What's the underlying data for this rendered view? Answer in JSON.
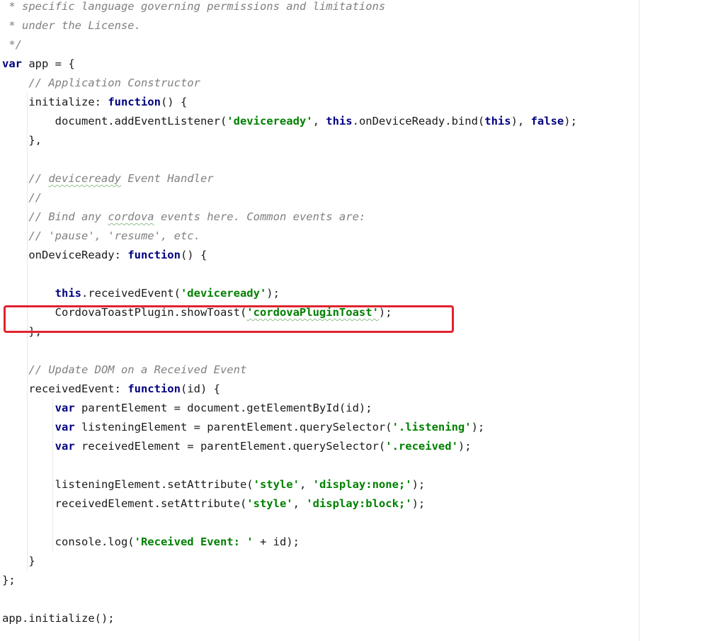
{
  "code": {
    "l0": " * specific language governing permissions and limitations",
    "l1": " * under the License.",
    "l2": " */",
    "l3": [
      "var",
      " app = {"
    ],
    "l4": [
      "    ",
      "// Application Constructor"
    ],
    "l5": [
      "    initialize: ",
      "function",
      "() {"
    ],
    "l6": [
      "        document.addEventListener(",
      "'deviceready'",
      ", ",
      "this",
      ".onDeviceReady.bind(",
      "this",
      "), ",
      "false",
      ");"
    ],
    "l7": "    },",
    "l9": [
      "    ",
      "// ",
      "deviceready",
      " Event Handler"
    ],
    "l10": [
      "    ",
      "//"
    ],
    "l11": [
      "    ",
      "// Bind any ",
      "cordova",
      " events here. Common events are:"
    ],
    "l12": [
      "    ",
      "// 'pause', 'resume', etc."
    ],
    "l13": [
      "    onDeviceReady: ",
      "function",
      "() {"
    ],
    "l15": [
      "        ",
      "this",
      ".receivedEvent(",
      "'deviceready'",
      ");"
    ],
    "l16": [
      "        CordovaToastPlugin.showToast(",
      "'cordovaPluginToast'",
      ");"
    ],
    "l17": "    },",
    "l19": [
      "    ",
      "// Update DOM on a Received Event"
    ],
    "l20": [
      "    receivedEvent: ",
      "function",
      "(id) {"
    ],
    "l21": [
      "        ",
      "var",
      " parentElement = document.getElementById(id);"
    ],
    "l22": [
      "        ",
      "var",
      " listeningElement = parentElement.querySelector(",
      "'.listening'",
      ");"
    ],
    "l23": [
      "        ",
      "var",
      " receivedElement = parentElement.querySelector(",
      "'.received'",
      ");"
    ],
    "l25": [
      "        listeningElement.setAttribute(",
      "'style'",
      ", ",
      "'display:none;'",
      ");"
    ],
    "l26": [
      "        receivedElement.setAttribute(",
      "'style'",
      ", ",
      "'display:block;'",
      ");"
    ],
    "l28": [
      "        console.log(",
      "'Received Event: '",
      " + id);"
    ],
    "l29": "    }",
    "l30": "};",
    "l32": "app.initialize();"
  },
  "highlight": {
    "color": "#e0242f"
  }
}
